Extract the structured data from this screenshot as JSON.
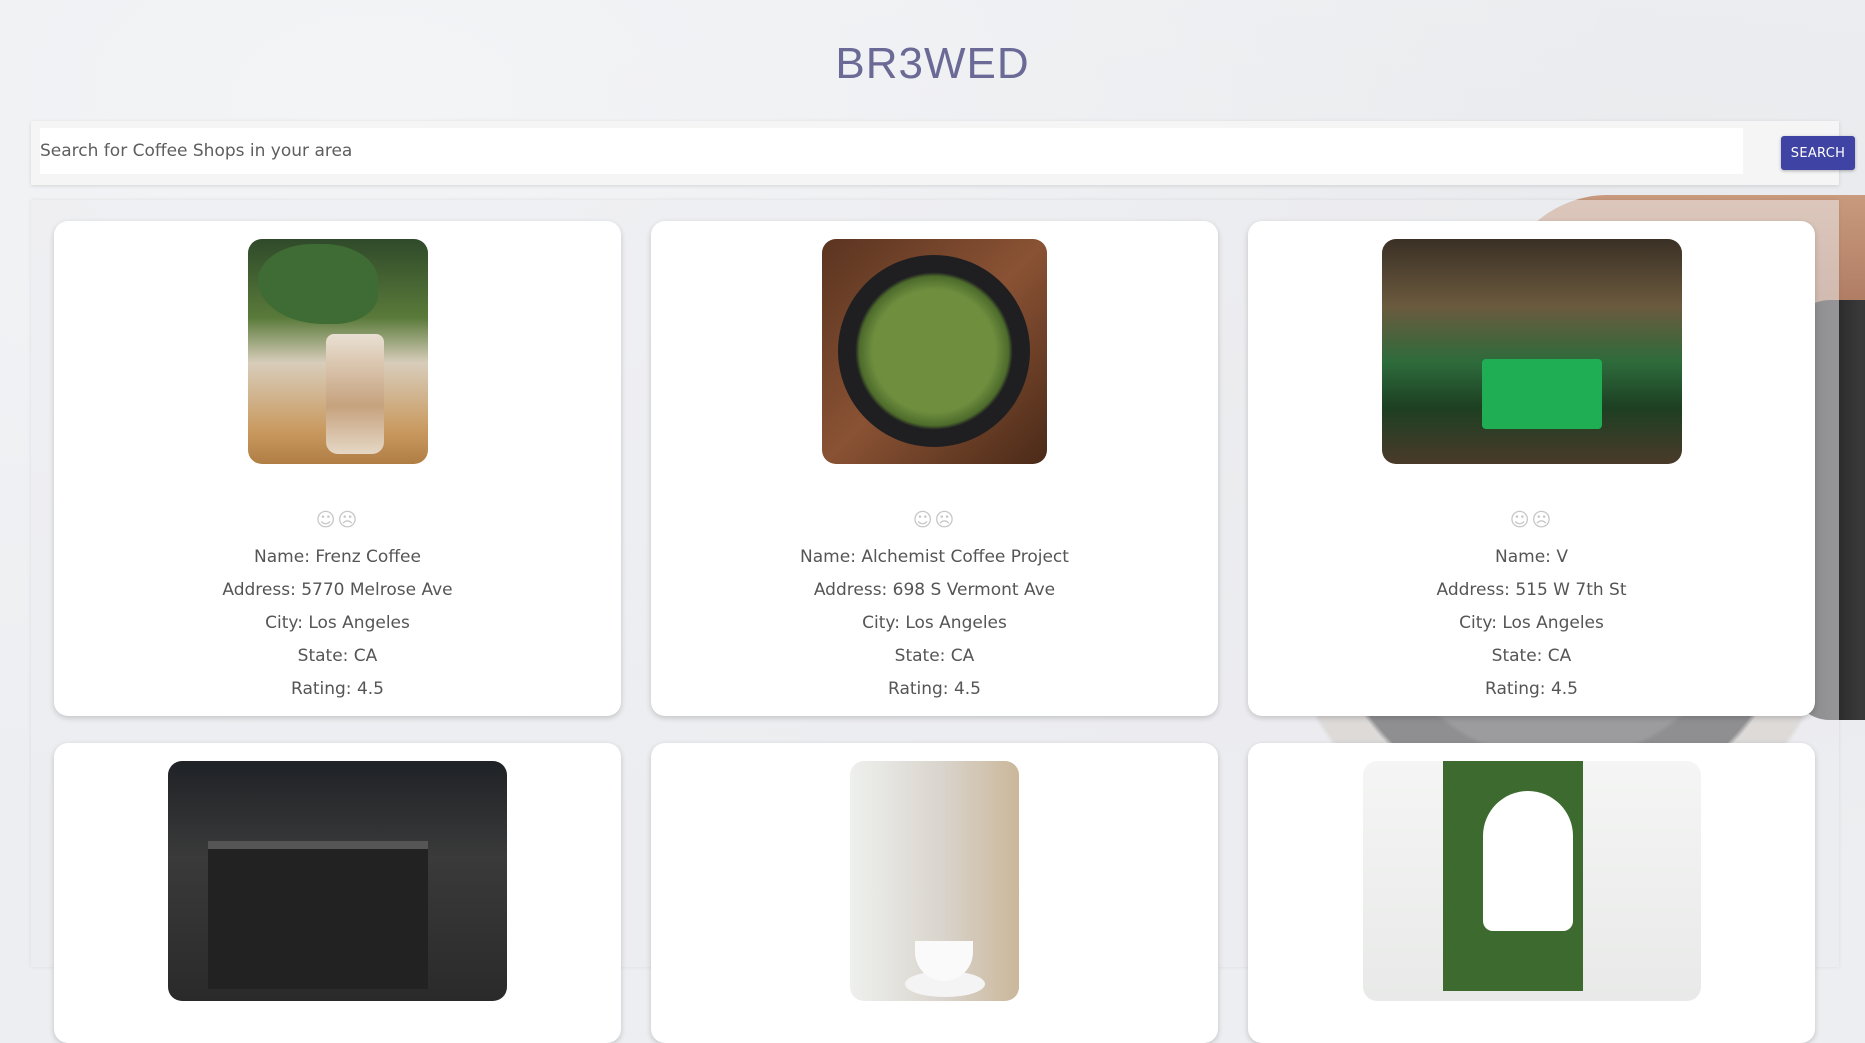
{
  "app": {
    "title": "BR3WED"
  },
  "search": {
    "placeholder": "Search for Coffee Shops in your area",
    "value": "",
    "button_label": "SEARCH"
  },
  "cards": [
    {
      "reactions": "☺☹",
      "name": "Name: Frenz Coffee",
      "address": "Address: 5770 Melrose Ave",
      "city": "City: Los Angeles",
      "state": "State: CA",
      "rating": "Rating: 4.5"
    },
    {
      "reactions": "☺☹",
      "name": "Name: Alchemist Coffee Project",
      "address": "Address: 698 S Vermont Ave",
      "city": "City: Los Angeles",
      "state": "State: CA",
      "rating": "Rating: 4.5"
    },
    {
      "reactions": "☺☹",
      "name": "Name: V",
      "address": "Address: 515 W 7th St",
      "city": "City: Los Angeles",
      "state": "State: CA",
      "rating": "Rating: 4.5"
    },
    {
      "partial": true
    },
    {
      "partial": true
    },
    {
      "partial": true
    }
  ],
  "colors": {
    "title": "#6b6a96",
    "accent_button": "#3f43a3",
    "background": "#eceef1",
    "card": "#ffffff"
  }
}
